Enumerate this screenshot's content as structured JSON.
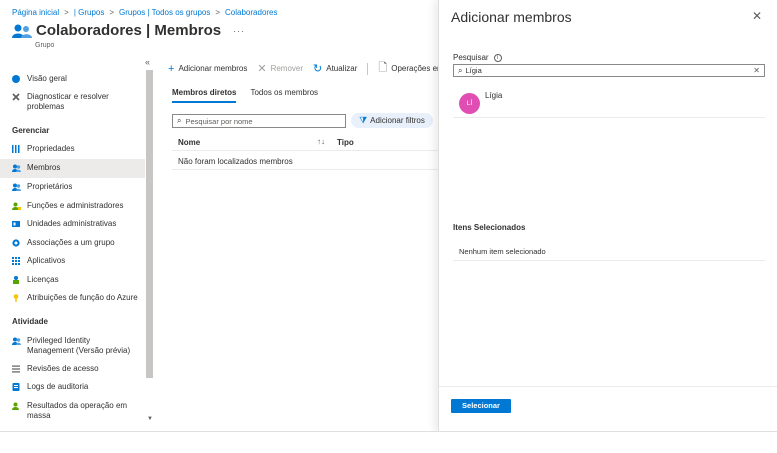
{
  "breadcrumb": {
    "items": [
      "Página inicial",
      "| Grupos",
      "Grupos | Todos os grupos",
      "Colaboradores"
    ],
    "sep": ">"
  },
  "header": {
    "title": "Colaboradores | Membros",
    "subtitle": "Grupo",
    "more": "···"
  },
  "sidebar": {
    "collapse": "«",
    "items_top": [
      {
        "label": "Visão geral",
        "icon": "info-icon"
      },
      {
        "label": "Diagnosticar e resolver problemas",
        "icon": "wrench-icon"
      }
    ],
    "section_manage": "Gerenciar",
    "items_manage": [
      {
        "label": "Propriedades",
        "icon": "properties-icon"
      },
      {
        "label": "Membros",
        "icon": "members-icon"
      },
      {
        "label": "Proprietários",
        "icon": "owners-icon"
      },
      {
        "label": "Funções e administradores",
        "icon": "roles-icon"
      },
      {
        "label": "Unidades administrativas",
        "icon": "admin-units-icon"
      },
      {
        "label": "Associações a um grupo",
        "icon": "group-membership-icon"
      },
      {
        "label": "Aplicativos",
        "icon": "apps-icon"
      },
      {
        "label": "Licenças",
        "icon": "licenses-icon"
      },
      {
        "label": "Atribuições de função do Azure",
        "icon": "key-icon"
      }
    ],
    "section_activity": "Atividade",
    "items_activity": [
      {
        "label": "Privileged Identity Management (Versão prévia)",
        "icon": "pim-icon"
      },
      {
        "label": "Revisões de acesso",
        "icon": "access-review-icon"
      },
      {
        "label": "Logs de auditoria",
        "icon": "audit-log-icon"
      },
      {
        "label": "Resultados da operação em massa",
        "icon": "bulk-ops-icon"
      }
    ]
  },
  "toolbar": {
    "add": "Adicionar membros",
    "remove": "Remover",
    "refresh": "Atualizar",
    "bulk": "Operações em"
  },
  "tabs": [
    "Membros diretos",
    "Todos os membros"
  ],
  "filter": {
    "search_placeholder": "Pesquisar por nome",
    "add_filters": "Adicionar filtros"
  },
  "table": {
    "col_name": "Nome",
    "col_sort": "↑↓",
    "col_type": "Tipo",
    "empty": "Não foram localizados membros"
  },
  "panel": {
    "title": "Adicionar membros",
    "close": "✕",
    "search_label": "Pesquisar",
    "info": "i",
    "search_value": "Lígia",
    "clear": "✕",
    "result": {
      "initials": "LÍ",
      "name": "Lígia"
    },
    "selected_title": "Itens Selecionados",
    "selected_empty": "Nenhum item selecionado",
    "select_button": "Selecionar"
  },
  "colors": {
    "accent": "#0078d4",
    "avatar": "#e04eb3"
  }
}
